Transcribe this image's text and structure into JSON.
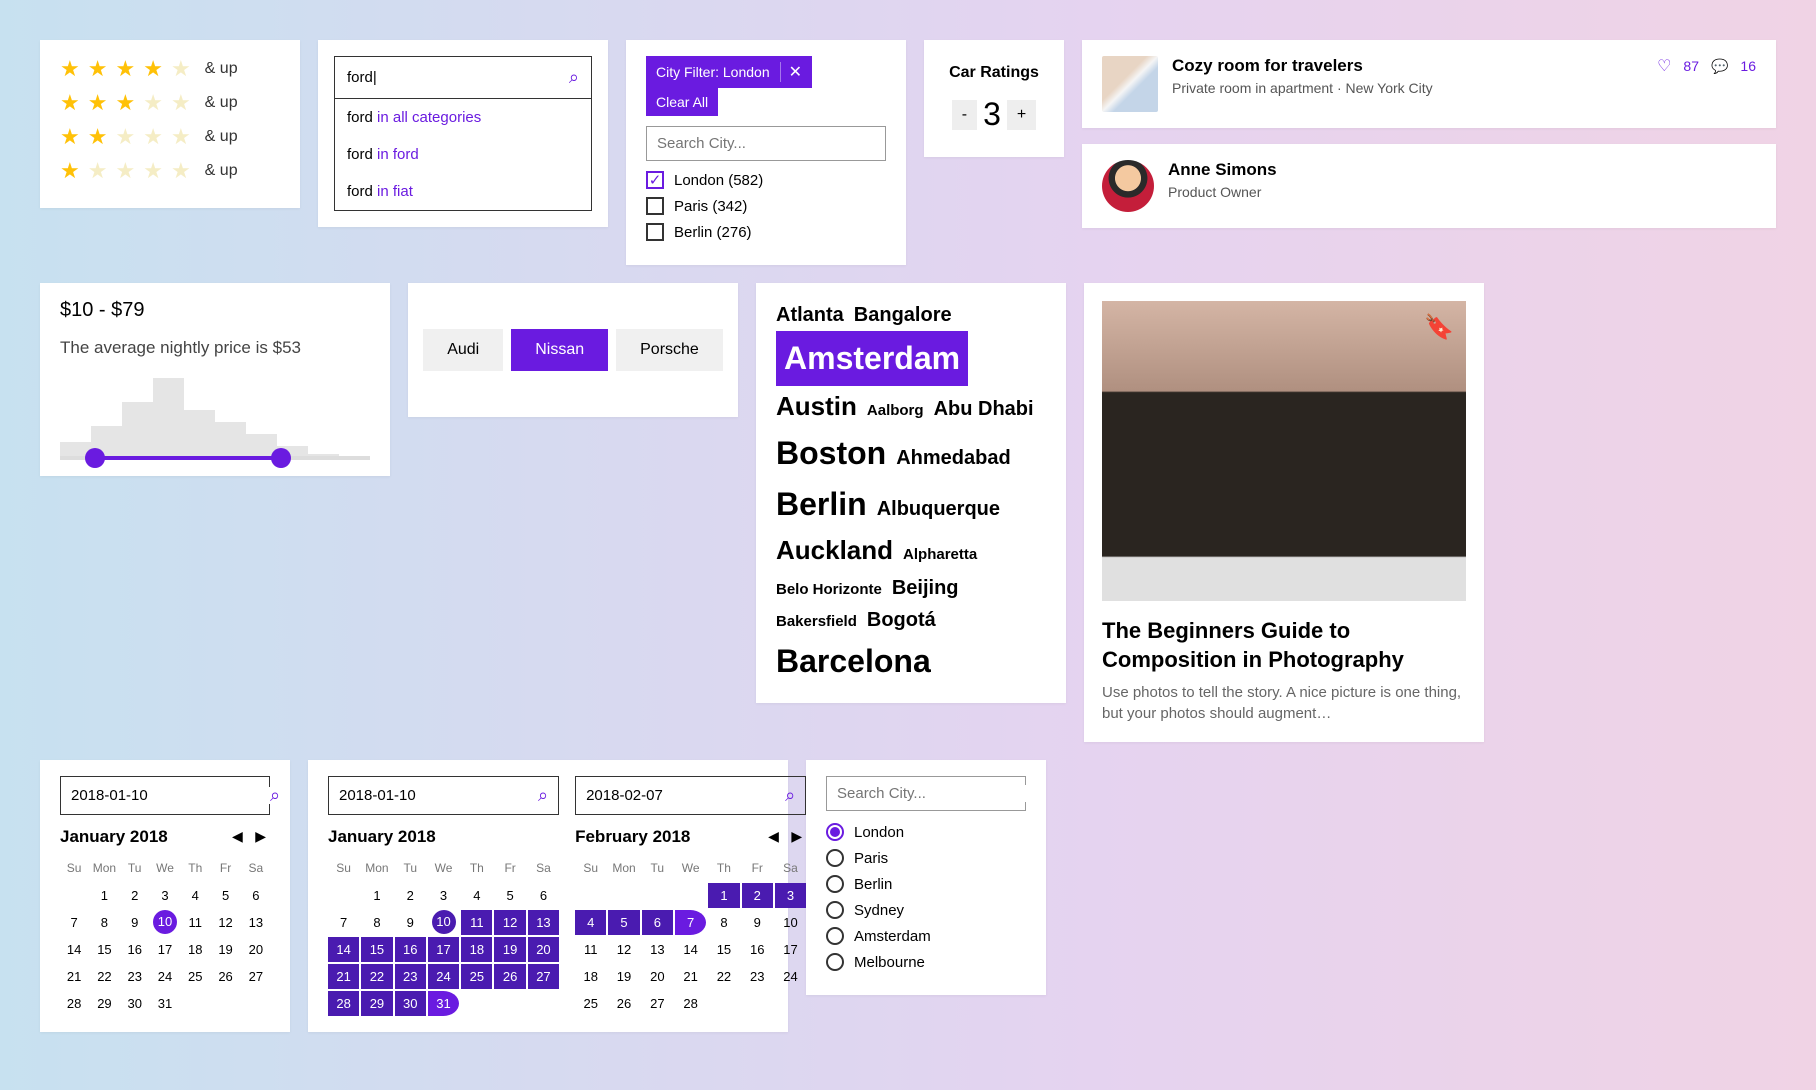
{
  "ratings": {
    "label": "& up",
    "rows": [
      4,
      3,
      2,
      1
    ]
  },
  "search": {
    "query": "ford|",
    "suggestions": [
      {
        "q": "ford",
        "in": "in all categories"
      },
      {
        "q": "ford",
        "in": "in ford"
      },
      {
        "q": "ford",
        "in": "in fiat"
      }
    ]
  },
  "city_filter": {
    "chip": "City Filter: London",
    "clear": "Clear All",
    "placeholder": "Search City...",
    "options": [
      {
        "label": "London (582)",
        "on": true
      },
      {
        "label": "Paris (342)",
        "on": false
      },
      {
        "label": "Berlin (276)",
        "on": false
      }
    ]
  },
  "car_ratings": {
    "title": "Car Ratings",
    "value": "3"
  },
  "listing": {
    "title": "Cozy room for travelers",
    "sub": "Private room in apartment · New York City",
    "likes": "87",
    "comments": "16"
  },
  "person": {
    "name": "Anne Simons",
    "role": "Product Owner"
  },
  "price": {
    "range": "$10 - $79",
    "avg": "The average nightly price is $53"
  },
  "segments": [
    "Audi",
    "Nissan",
    "Porsche"
  ],
  "segments_selected": 1,
  "cloud": [
    {
      "t": "Atlanta",
      "s": 2
    },
    {
      "t": "Bangalore",
      "s": 2
    },
    {
      "t": "Amsterdam",
      "s": 4,
      "sel": true
    },
    {
      "t": "Austin",
      "s": 3
    },
    {
      "t": "Aalborg",
      "s": 1
    },
    {
      "t": "Abu Dhabi",
      "s": 2
    },
    {
      "t": "Boston",
      "s": 4
    },
    {
      "t": "Ahmedabad",
      "s": 2
    },
    {
      "t": "Berlin",
      "s": 4
    },
    {
      "t": "Albuquerque",
      "s": 2
    },
    {
      "t": "Auckland",
      "s": 3
    },
    {
      "t": "Alpharetta",
      "s": 1
    },
    {
      "t": "Belo Horizonte",
      "s": 1
    },
    {
      "t": "Beijing",
      "s": 2
    },
    {
      "t": "Bakersfield",
      "s": 1
    },
    {
      "t": "Bogotá",
      "s": 2
    },
    {
      "t": "Barcelona",
      "s": 4
    }
  ],
  "cal1": {
    "date": "2018-01-10",
    "title": "January 2018",
    "sel": 10
  },
  "cal2": {
    "date1": "2018-01-10",
    "date2": "2018-02-07",
    "title1": "January 2018",
    "title2": "February 2018"
  },
  "radio_city": {
    "placeholder": "Search City...",
    "options": [
      "London",
      "Paris",
      "Berlin",
      "Sydney",
      "Amsterdam",
      "Melbourne"
    ],
    "selected": 0
  },
  "article": {
    "title": "The Beginners Guide to Composition in Photography",
    "sub": "Use photos to tell the story. A nice picture is one thing, but your photos should augment…"
  },
  "days": [
    "Su",
    "Mon",
    "Tu",
    "We",
    "Th",
    "Fr",
    "Sa"
  ]
}
